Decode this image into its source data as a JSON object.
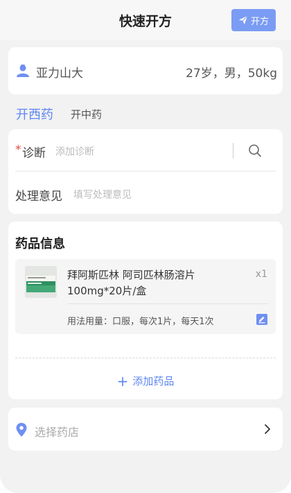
{
  "header": {
    "title": "快速开方",
    "send_label": "开方",
    "send_icon": "paper-plane-icon"
  },
  "patient": {
    "name": "亚力山大",
    "info": "27岁，男，50kg",
    "icon": "user-avatar-icon"
  },
  "tabs": [
    {
      "label": "开西药",
      "active": true
    },
    {
      "label": "开中药",
      "active": false
    }
  ],
  "diagnosis": {
    "required_mark": "*",
    "label": "诊断",
    "placeholder": "添加诊断",
    "opinion_label": "处理意见",
    "opinion_placeholder": "填写处理意见"
  },
  "drugs": {
    "section_title": "药品信息",
    "items": [
      {
        "name": "拜阿斯匹林 阿司匹林肠溶片",
        "spec": "100mg*20片/盒",
        "qty": "x1",
        "usage": "用法用量：口服，每次1片，每天1次"
      }
    ],
    "add_label": "添加药品"
  },
  "pharmacy": {
    "placeholder": "选择药店"
  },
  "colors": {
    "accent": "#5e86f2",
    "button": "#7b9cf4",
    "required": "#e5483c",
    "background": "#f2f2f2"
  }
}
